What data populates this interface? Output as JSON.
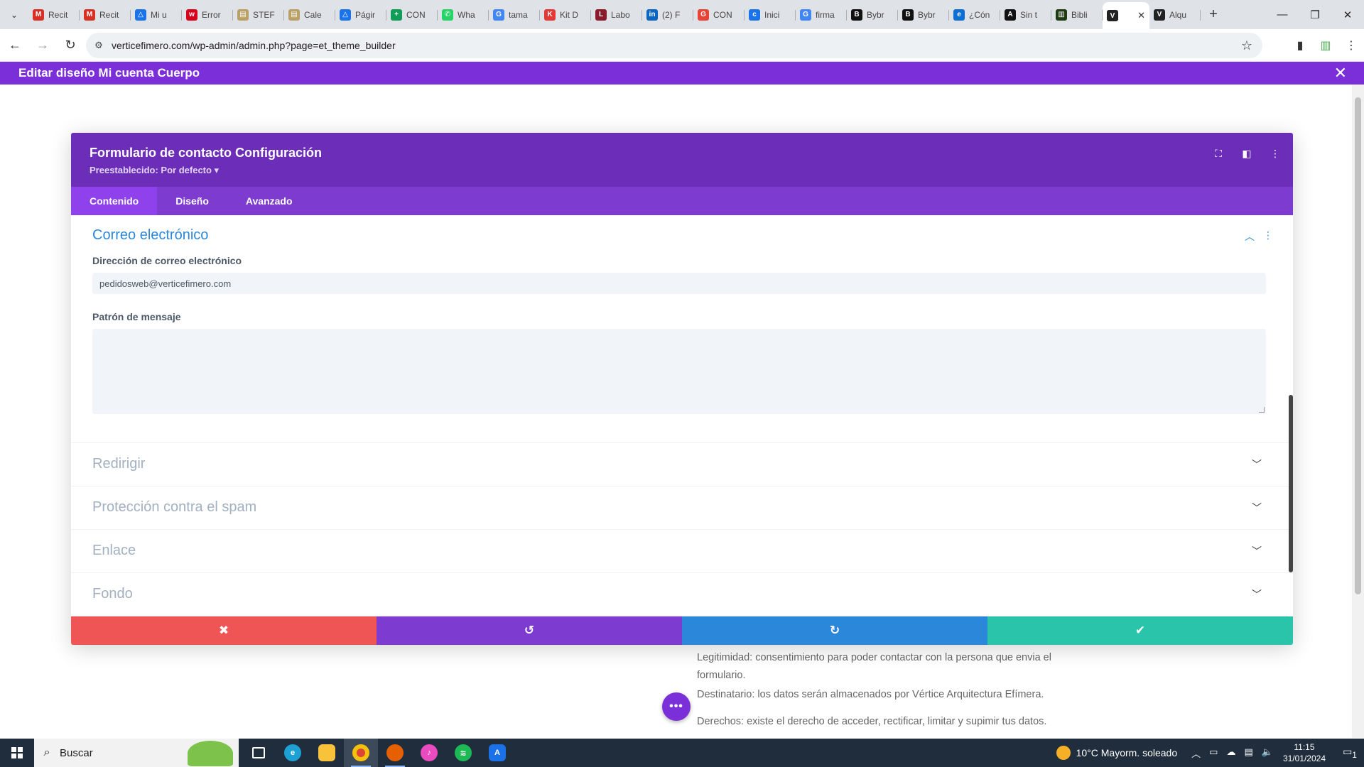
{
  "browser": {
    "tabs": [
      {
        "title": "Recit",
        "icon": "gmail-icon",
        "color": "#d93025",
        "glyph": "M"
      },
      {
        "title": "Recit",
        "icon": "gmail-icon",
        "color": "#d93025",
        "glyph": "M"
      },
      {
        "title": "Mi u",
        "icon": "drive-icon",
        "color": "#1a73e8",
        "glyph": "△"
      },
      {
        "title": "Error",
        "icon": "error-site-icon",
        "color": "#d9001b",
        "glyph": "w"
      },
      {
        "title": "STEF",
        "icon": "folder-site-icon",
        "color": "#b9a064",
        "glyph": "▤"
      },
      {
        "title": "Cale",
        "icon": "calendar-site-icon",
        "color": "#b9a064",
        "glyph": "▤"
      },
      {
        "title": "Págir",
        "icon": "drive-icon",
        "color": "#1a73e8",
        "glyph": "△"
      },
      {
        "title": "CON",
        "icon": "sheets-icon",
        "color": "#0f9d58",
        "glyph": "+"
      },
      {
        "title": "Wha",
        "icon": "whatsapp-icon",
        "color": "#25d366",
        "glyph": "✆"
      },
      {
        "title": "tama",
        "icon": "google-icon",
        "color": "#4285f4",
        "glyph": "G"
      },
      {
        "title": "Kit D",
        "icon": "kit-digital-icon",
        "color": "#e53935",
        "glyph": "K"
      },
      {
        "title": "Labo",
        "icon": "labo-site-icon",
        "color": "#8b1a2b",
        "glyph": "L"
      },
      {
        "title": "(2) F",
        "icon": "linkedin-icon",
        "color": "#0a66c2",
        "glyph": "in"
      },
      {
        "title": "CON",
        "icon": "gmail-red-icon",
        "color": "#ea4335",
        "glyph": "G"
      },
      {
        "title": "Inici",
        "icon": "chat-site-icon",
        "color": "#1a73e8",
        "glyph": "c"
      },
      {
        "title": "firma",
        "icon": "google-icon",
        "color": "#4285f4",
        "glyph": "G"
      },
      {
        "title": "Bybr",
        "icon": "bybrand-icon",
        "color": "#111111",
        "glyph": "B"
      },
      {
        "title": "Bybr",
        "icon": "bybrand-icon",
        "color": "#111111",
        "glyph": "B"
      },
      {
        "title": "¿Cón",
        "icon": "edge-site-icon",
        "color": "#0b6fd6",
        "glyph": "e"
      },
      {
        "title": "Sin t",
        "icon": "site-a-icon",
        "color": "#111111",
        "glyph": "A"
      },
      {
        "title": "Bibli",
        "icon": "library-site-icon",
        "color": "#1f3b12",
        "glyph": "▥"
      },
      {
        "title": "",
        "icon": "divi-v-icon",
        "color": "#222222",
        "glyph": "V",
        "active": true
      },
      {
        "title": "Alqu",
        "icon": "divi-v-icon",
        "color": "#222222",
        "glyph": "V"
      }
    ],
    "url": "verticefimero.com/wp-admin/admin.php?page=et_theme_builder"
  },
  "divi_bar": {
    "title": "Editar diseño Mi cuenta Cuerpo"
  },
  "modal": {
    "title": "Formulario de contacto Configuración",
    "preset": "Preestablecido: Por defecto ▾",
    "tabs": [
      {
        "label": "Contenido",
        "active": true
      },
      {
        "label": "Diseño",
        "active": false
      },
      {
        "label": "Avanzado",
        "active": false
      }
    ],
    "open_section": {
      "title": "Correo electrónico",
      "email_label": "Dirección de correo electrónico",
      "email_value": "pedidosweb@verticefimero.com",
      "message_label": "Patrón de mensaje",
      "message_value": ""
    },
    "sections": [
      "Redirigir",
      "Protección contra el spam",
      "Enlace",
      "Fondo"
    ]
  },
  "background_page": {
    "lines": [
      "Legitimidad: consentimiento para poder contactar con la persona que envia el formulario.",
      "Destinatario: los datos serán almacenados por Vértice Arquitectura Efímera.",
      "Derechos: existe el derecho de acceder, rectificar, limitar y supimir tus datos."
    ]
  },
  "taskbar": {
    "search_placeholder": "Buscar",
    "weather": "10°C  Mayorm. soleado",
    "time": "11:15",
    "date": "31/01/2024",
    "notifications": "1"
  },
  "colors": {
    "divi_purple": "#7b2fd8",
    "modal_header": "#6c2eb9",
    "cancel_red": "#ef5555",
    "undo_purple": "#7e3bd0",
    "redo_blue": "#2b87da",
    "save_green": "#29c4a9"
  }
}
